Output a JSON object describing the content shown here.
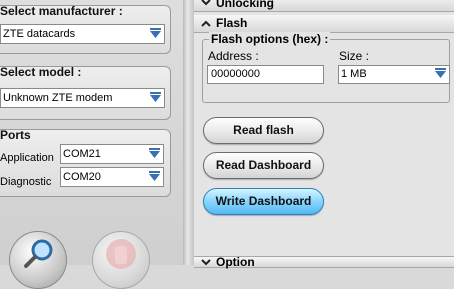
{
  "left_panel": {
    "manufacturer": {
      "title": "Select manufacturer :",
      "value": "ZTE datacards"
    },
    "model": {
      "title": "Select model :",
      "value": "Unknown ZTE modem"
    },
    "ports": {
      "title": "Ports",
      "application_label": "Application",
      "application_value": "COM21",
      "diagnostic_label": "Diagnostic",
      "diagnostic_value": "COM20"
    }
  },
  "right_panel": {
    "unlocking_header": "Unlocking",
    "flash_header": "Flash",
    "flash_options": {
      "legend": "Flash options (hex) :",
      "address_label": "Address :",
      "address_value": "00000000",
      "size_label": "Size :",
      "size_value": "1 MB"
    },
    "buttons": {
      "read_flash": "Read flash",
      "read_dashboard": "Read Dashboard",
      "write_dashboard": "Write Dashboard"
    },
    "bottom_header_partial": "Option"
  },
  "colors": {
    "active_button": "#52b9f2",
    "select_arrow": "#3a6fb0"
  }
}
